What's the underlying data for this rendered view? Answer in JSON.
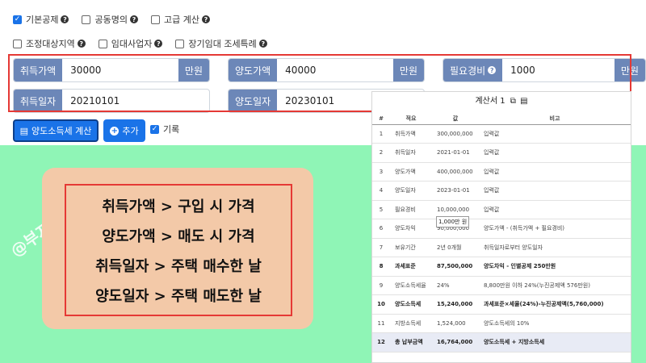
{
  "options_row1": [
    {
      "label": "기본공제",
      "checked": true,
      "help": true
    },
    {
      "label": "공동명의",
      "checked": false,
      "help": true
    },
    {
      "label": "고급 계산",
      "checked": false,
      "help": true
    }
  ],
  "options_row2": [
    {
      "label": "조정대상지역",
      "checked": false,
      "help": true
    },
    {
      "label": "임대사업자",
      "checked": false,
      "help": true
    },
    {
      "label": "장기임대 조세특례",
      "checked": false,
      "help": true
    }
  ],
  "inputs": {
    "acq_price": {
      "label": "취득가액",
      "value": "30000",
      "unit": "만원"
    },
    "sale_price": {
      "label": "양도가액",
      "value": "40000",
      "unit": "만원"
    },
    "expense": {
      "label": "필요경비",
      "value": "1000",
      "unit": "만원",
      "help": true
    },
    "acq_date": {
      "label": "취득일자",
      "value": "20210101"
    },
    "sale_date": {
      "label": "양도일자",
      "value": "20230101"
    }
  },
  "buttons": {
    "calc": "양도소득세 계산",
    "add": "추가",
    "record": "기록",
    "record_checked": true
  },
  "callout": {
    "lines": [
      "취득가액 > 구입 시 가격",
      "양도가액 > 매도 시 가격",
      "취득일자 > 주택 매수한 날",
      "양도일자 > 주택 매도한 날"
    ]
  },
  "watermark": "@부지런한 개미",
  "panel": {
    "title": "계산서 1",
    "headers": [
      "#",
      "적요",
      "값",
      "비고"
    ],
    "tooltip": "1,000만 원",
    "rows": [
      {
        "n": "1",
        "item": "취득가액",
        "value": "300,000,000",
        "note": "입력값"
      },
      {
        "n": "2",
        "item": "취득일자",
        "value": "2021-01-01",
        "note": "입력값"
      },
      {
        "n": "3",
        "item": "양도가액",
        "value": "400,000,000",
        "note": "입력값"
      },
      {
        "n": "4",
        "item": "양도일자",
        "value": "2023-01-01",
        "note": "입력값"
      },
      {
        "n": "5",
        "item": "필요경비",
        "value": "10,000,000",
        "note": "입력값"
      },
      {
        "n": "6",
        "item": "양도차익",
        "value": "90,000,000",
        "note": "양도가액 - (취득가액 + 필요경비)"
      },
      {
        "n": "7",
        "item": "보유기간",
        "value": "2년 0개월",
        "note": "취득일자로부터 양도일자"
      },
      {
        "n": "8",
        "item": "과세표준",
        "value": "87,500,000",
        "note": "양도차익 - 인별공제 250만원",
        "bold": true
      },
      {
        "n": "9",
        "item": "양도소득세율",
        "value": "24%",
        "note": "8,800만원 이하 24%(누진공제액 576만원)"
      },
      {
        "n": "10",
        "item": "양도소득세",
        "value": "15,240,000",
        "note": "과세표준×세율(24%)-누진공제액(5,760,000)",
        "bold": true
      },
      {
        "n": "11",
        "item": "지방소득세",
        "value": "1,524,000",
        "note": "양도소득세의 10%"
      },
      {
        "n": "12",
        "item": "총 납부금액",
        "value": "16,764,000",
        "note": "양도소득세 + 지방소득세",
        "bold": true,
        "highlight": true
      }
    ]
  },
  "colors": {
    "background": "#8ff5b6",
    "label_bg": "#6c87b8",
    "accent": "#1a73e8",
    "outline": "#e53935",
    "callout_bg": "#f3c9a8"
  }
}
